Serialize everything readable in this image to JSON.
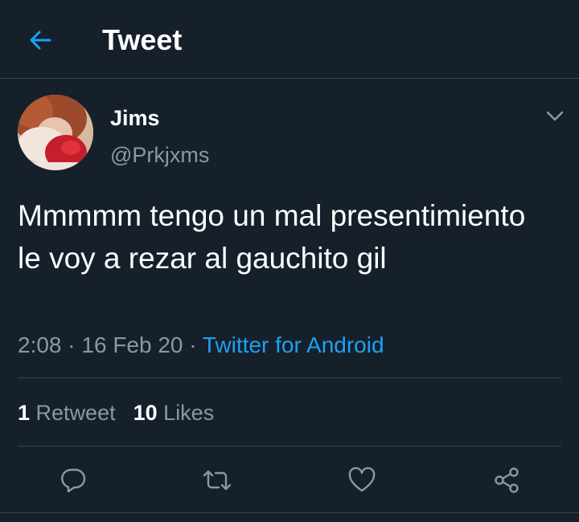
{
  "header": {
    "title": "Tweet",
    "back_icon": "arrow-left-icon"
  },
  "colors": {
    "background": "#15202b",
    "accent": "#1da1f2",
    "secondary_text": "#8899a6",
    "divider": "#38444d"
  },
  "author": {
    "display_name": "Jims",
    "handle": "@Prkjxms"
  },
  "tweet": {
    "text": "Mmmmm tengo un mal presentimiento le voy a rezar al gauchito gil",
    "time": "2:08",
    "date": "16 Feb 20",
    "separator": " · ",
    "source": "Twitter for Android"
  },
  "stats": {
    "retweets": {
      "count": "1",
      "label": "Retweet"
    },
    "likes": {
      "count": "10",
      "label": "Likes"
    }
  },
  "actions": [
    {
      "name": "reply",
      "icon": "speech-bubble-icon"
    },
    {
      "name": "retweet",
      "icon": "retweet-arrows-icon"
    },
    {
      "name": "like",
      "icon": "heart-icon"
    },
    {
      "name": "share",
      "icon": "share-nodes-icon"
    }
  ]
}
